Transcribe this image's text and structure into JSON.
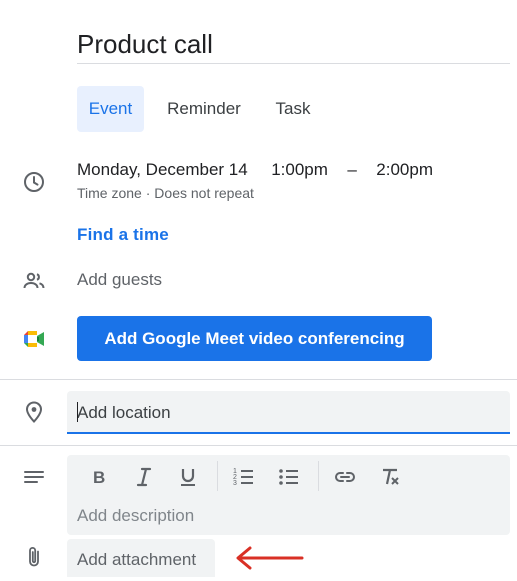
{
  "event": {
    "title": "Product call",
    "tabs": [
      {
        "label": "Event",
        "active": true
      },
      {
        "label": "Reminder",
        "active": false
      },
      {
        "label": "Task",
        "active": false
      }
    ],
    "date": "Monday, December 14",
    "start_time": "1:00pm",
    "time_sep": "–",
    "end_time": "2:00pm",
    "timezone_label": "Time zone",
    "dot": "·",
    "repeat_label": "Does not repeat",
    "find_time_label": "Find a time",
    "guests_placeholder": "Add guests",
    "meet_button_label": "Add Google Meet video conferencing",
    "location_placeholder": "Add location",
    "description_placeholder": "Add description",
    "attachment_label": "Add attachment"
  },
  "icons": {
    "clock": "clock-icon",
    "people": "people-icon",
    "meet": "google-meet-icon",
    "location": "location-pin-icon",
    "description": "notes-icon",
    "attachment": "paperclip-icon",
    "bold": "bold-icon",
    "italic": "italic-icon",
    "underline": "underline-icon",
    "numbered_list": "numbered-list-icon",
    "bulleted_list": "bulleted-list-icon",
    "link": "link-icon",
    "clear_format": "clear-formatting-icon",
    "arrow": "red-arrow-icon"
  },
  "colors": {
    "accent": "#1a73e8",
    "field_bg": "#f1f3f4",
    "annotation_arrow": "#d93025"
  }
}
